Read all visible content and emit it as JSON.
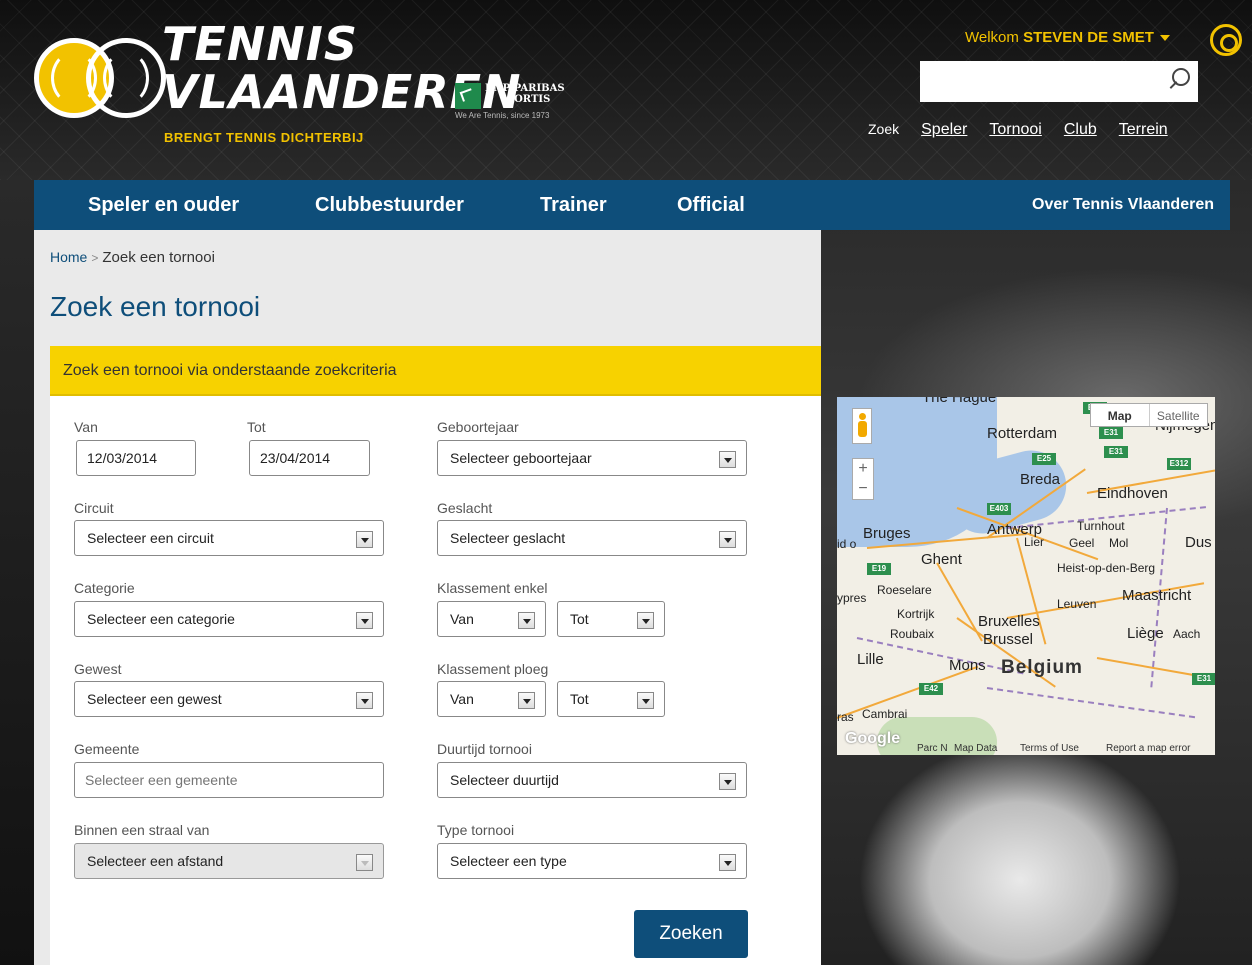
{
  "header": {
    "logo_line1": "TENNIS",
    "logo_line2": "VLAANDEREN",
    "tagline": "BRENGT TENNIS DICHTERBIJ",
    "sponsor_name1": "BNP PARIBAS",
    "sponsor_name2": "FORTIS",
    "sponsor_sub": "We Are Tennis, since 1973",
    "welcome_prefix": "Welkom",
    "user_name": "STEVEN DE SMET",
    "search_value": "",
    "search_label": "Zoek",
    "search_links": [
      "Speler",
      "Tornooi",
      "Club",
      "Terrein"
    ]
  },
  "nav": {
    "items": [
      "Speler en ouder",
      "Clubbestuurder",
      "Trainer",
      "Official"
    ],
    "right": "Over Tennis Vlaanderen"
  },
  "breadcrumb": {
    "home": "Home",
    "sep": ">",
    "current": "Zoek een tornooi"
  },
  "page_title": "Zoek een tornooi",
  "form": {
    "header": "Zoek een tornooi via onderstaande zoekcriteria",
    "van_label": "Van",
    "van_value": "12/03/2014",
    "tot_label": "Tot",
    "tot_value": "23/04/2014",
    "geboortejaar_label": "Geboortejaar",
    "geboortejaar_value": "Selecteer geboortejaar",
    "circuit_label": "Circuit",
    "circuit_value": "Selecteer een circuit",
    "geslacht_label": "Geslacht",
    "geslacht_value": "Selecteer geslacht",
    "categorie_label": "Categorie",
    "categorie_value": "Selecteer een categorie",
    "klassement_enkel_label": "Klassement enkel",
    "klassement_enkel_van": "Van",
    "klassement_enkel_tot": "Tot",
    "gewest_label": "Gewest",
    "gewest_value": "Selecteer een gewest",
    "klassement_ploeg_label": "Klassement ploeg",
    "klassement_ploeg_van": "Van",
    "klassement_ploeg_tot": "Tot",
    "gemeente_label": "Gemeente",
    "gemeente_placeholder": "Selecteer een gemeente",
    "duurtijd_label": "Duurtijd tornooi",
    "duurtijd_value": "Selecteer duurtijd",
    "straal_label": "Binnen een straal van",
    "straal_value": "Selecteer een afstand",
    "type_label": "Type tornooi",
    "type_value": "Selecteer een type",
    "submit_label": "Zoeken"
  },
  "map": {
    "type_map": "Map",
    "type_satellite": "Satellite",
    "zoom_in": "+",
    "zoom_out": "−",
    "labels": {
      "the_hague": "The Hague",
      "rotterdam": "Rotterdam",
      "nijmegen": "Nijmegen",
      "breda": "Breda",
      "eindhoven": "Eindhoven",
      "bruges": "Bruges",
      "antwerp": "Antwerp",
      "turnhout": "Turnhout",
      "lier": "Lier",
      "geel": "Geel",
      "mol": "Mol",
      "dus": "Dus",
      "ghent": "Ghent",
      "heist": "Heist-op-den-Berg",
      "roeselare": "Roeselare",
      "ypres": "ypres",
      "kortrijk": "Kortrijk",
      "leuven": "Leuven",
      "maastricht": "Maastricht",
      "bruxelles": "Bruxelles",
      "brussel": "Brussel",
      "roubaix": "Roubaix",
      "liege": "Liège",
      "aachen": "Aach",
      "lille": "Lille",
      "mons": "Mons",
      "belgium": "Belgium",
      "cambrai": "Cambrai",
      "arras": "ras",
      "ido": "id o"
    },
    "shields": [
      "E31",
      "E19",
      "E25",
      "E31",
      "E312",
      "E403",
      "E19",
      "E42"
    ],
    "footer": {
      "google": "Google",
      "parc": "Parc N",
      "map_data": "Map Data",
      "terms": "Terms of Use",
      "report": "Report a map error"
    }
  }
}
